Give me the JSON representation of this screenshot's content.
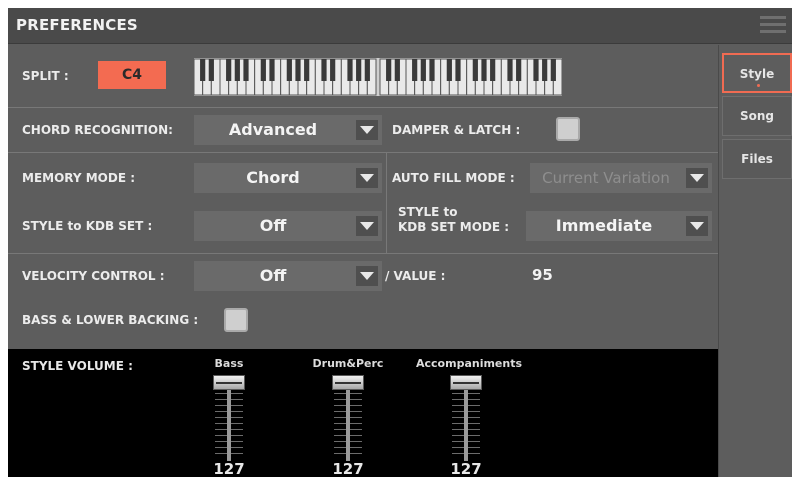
{
  "window": {
    "title": "PREFERENCES"
  },
  "split": {
    "label": "SPLIT :",
    "value": "C4"
  },
  "chord_recognition": {
    "label": "CHORD RECOGNITION:",
    "value": "Advanced"
  },
  "damper_latch": {
    "label": "DAMPER & LATCH :",
    "checked": false
  },
  "memory_mode": {
    "label": "MEMORY MODE :",
    "value": "Chord"
  },
  "auto_fill_mode": {
    "label": "AUTO FILL MODE :",
    "value": "Current Variation",
    "disabled": true
  },
  "style_to_kdb": {
    "label": "STYLE to KDB SET :",
    "value": "Off"
  },
  "style_to_kdb_mode": {
    "label_line1": "STYLE to",
    "label_line2": "KDB SET MODE :",
    "value": "Immediate"
  },
  "velocity_control": {
    "label": "VELOCITY CONTROL :",
    "value": "Off"
  },
  "velocity_value": {
    "label": "/ VALUE :",
    "value": "95"
  },
  "bass_lower_backing": {
    "label": "BASS & LOWER BACKING :",
    "checked": false
  },
  "style_volume": {
    "label": "STYLE VOLUME :",
    "channels": [
      {
        "name": "Bass",
        "value": "127"
      },
      {
        "name": "Drum&Perc",
        "value": "127"
      },
      {
        "name": "Accompaniments",
        "value": "127"
      }
    ]
  },
  "tabs": [
    {
      "label": "Style",
      "active": true
    },
    {
      "label": "Song",
      "active": false
    },
    {
      "label": "Files",
      "active": false
    }
  ],
  "colors": {
    "accent": "#f36b51",
    "background": "#5d5d5d",
    "panel": "#000000"
  }
}
